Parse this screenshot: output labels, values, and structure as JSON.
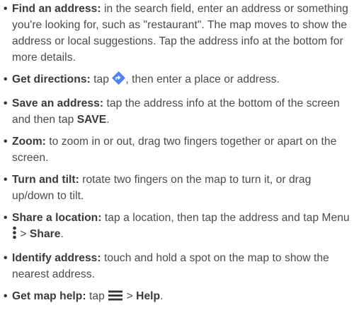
{
  "items": [
    {
      "term": "Find an address:",
      "text": " in the search field, enter an address or something you're looking for, such as \"restaurant\". The map moves to show the address or local suggestions. Tap the address info at the bottom for more details."
    },
    {
      "term": "Get directions:",
      "text_before": " tap ",
      "icon": "directions-diamond-icon",
      "text_after": ", then enter a place or address."
    },
    {
      "term": "Save an address:",
      "text": " tap the address info at the bottom of the screen and then tap ",
      "emphasis": "SAVE",
      "text_end": "."
    },
    {
      "term": "Zoom:",
      "text": " to zoom in or out, drag two fingers together or apart on the screen."
    },
    {
      "term": "Turn and tilt:",
      "text": " rotate two fingers on the map to turn it, or drag up/down to tilt."
    },
    {
      "term": "Share a location:",
      "text": " tap a location, then tap the address and tap Menu ",
      "icon": "vertical-dots-menu-icon",
      "sep": " > ",
      "emphasis": "Share",
      "text_end": "."
    },
    {
      "term": "Identify address:",
      "text": " touch and hold a spot on the map to show the nearest address."
    },
    {
      "term": "Get map help:",
      "text_before": " tap ",
      "icon": "hamburger-menu-icon",
      "sep": " > ",
      "emphasis": "Help",
      "text_end": "."
    }
  ],
  "colors": {
    "text": "#4a4a4a",
    "directions_icon": "#4f83f4"
  }
}
